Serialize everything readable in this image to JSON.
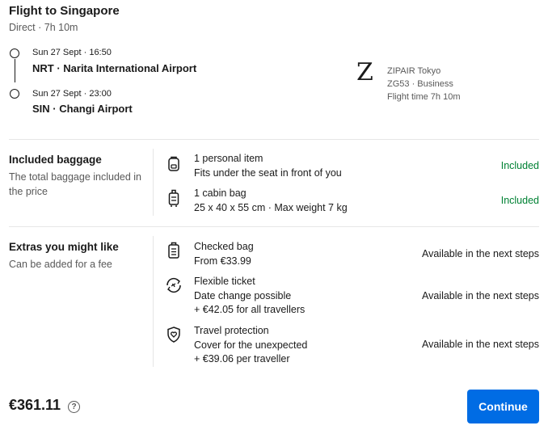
{
  "flight": {
    "title": "Flight to Singapore",
    "subtitle": "Direct · 7h 10m",
    "departure": {
      "time": "Sun 27 Sept · 16:50",
      "airport": "NRT · Narita International Airport"
    },
    "arrival": {
      "time": "Sun 27 Sept · 23:00",
      "airport": "SIN · Changi Airport"
    },
    "airline": {
      "logo_letter": "Z",
      "name": "ZIPAIR Tokyo",
      "code_class": "ZG53 · Business",
      "flight_time": "Flight time 7h 10m"
    }
  },
  "baggage": {
    "title": "Included baggage",
    "description": "The total baggage included in the price",
    "items": [
      {
        "icon": "backpack-icon",
        "name": "1 personal item",
        "detail": "Fits under the seat in front of you",
        "status": "Included"
      },
      {
        "icon": "suitcase-icon",
        "name": "1 cabin bag",
        "detail": "25 x 40 x 55 cm · Max weight 7 kg",
        "status": "Included"
      }
    ]
  },
  "extras": {
    "title": "Extras you might like",
    "description": "Can be added for a fee",
    "items": [
      {
        "icon": "checked-bag-icon",
        "name": "Checked bag",
        "line2": "From €33.99",
        "status": "Available in the next steps"
      },
      {
        "icon": "flexible-ticket-icon",
        "name": "Flexible ticket",
        "line2": "Date change possible",
        "line3": "+ €42.05 for all travellers",
        "status": "Available in the next steps"
      },
      {
        "icon": "shield-heart-icon",
        "name": "Travel protection",
        "line2": "Cover for the unexpected",
        "line3": "+ €39.06 per traveller",
        "status": "Available in the next steps"
      }
    ]
  },
  "footer": {
    "price": "€361.11",
    "help_symbol": "?",
    "continue_label": "Continue"
  },
  "colors": {
    "accent": "#006ce4",
    "included": "#008234",
    "muted": "#595959",
    "divider": "#e6e6e6"
  }
}
